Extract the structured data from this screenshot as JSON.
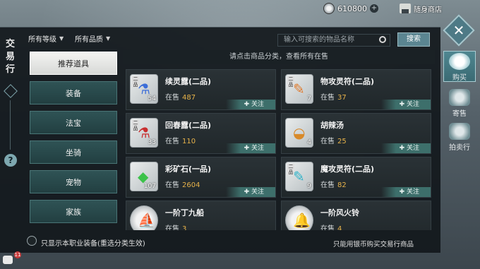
{
  "topbar": {
    "currency_value": "610800",
    "shop_label": "随身商店"
  },
  "sidebar": {
    "title": "交易行"
  },
  "filters": {
    "level": "所有等级",
    "quality": "所有品质"
  },
  "search": {
    "placeholder": "输入可搜索的物品名称",
    "button_label": "搜索"
  },
  "categories": [
    {
      "label": "推荐道具",
      "active": true
    },
    {
      "label": "装备"
    },
    {
      "label": "法宝"
    },
    {
      "label": "坐骑"
    },
    {
      "label": "宠物"
    },
    {
      "label": "家族"
    }
  ],
  "hint": "请点击商品分类，查看所有在售",
  "sale_label": "在售",
  "follow_label": "关注",
  "items": [
    {
      "name": "续灵露(二品)",
      "count_on_sale": "487",
      "stack": "54",
      "grade": "二品",
      "icon": "blue-potion-icon",
      "glyph": "⚗",
      "glyph_color": "#3c6ed8"
    },
    {
      "name": "物攻灵符(二品)",
      "count_on_sale": "37",
      "stack": "7",
      "grade": "二品",
      "icon": "orange-talisman-icon",
      "glyph": "✎",
      "glyph_color": "#e07a2c"
    },
    {
      "name": "回春露(二品)",
      "count_on_sale": "110",
      "stack": "33",
      "grade": "二品",
      "icon": "red-potion-icon",
      "glyph": "⚗",
      "glyph_color": "#c83030"
    },
    {
      "name": "胡辣汤",
      "count_on_sale": "25",
      "stack": "4",
      "grade": "",
      "icon": "soup-bowl-icon",
      "glyph": "◒",
      "glyph_color": "#d88a2a"
    },
    {
      "name": "彩矿石(一品)",
      "count_on_sale": "2604",
      "stack": "107",
      "grade": "",
      "icon": "green-ore-icon",
      "glyph": "◆",
      "glyph_color": "#3cc24a"
    },
    {
      "name": "魔攻灵符(二品)",
      "count_on_sale": "82",
      "stack": "9",
      "grade": "二品",
      "icon": "cyan-talisman-icon",
      "glyph": "✎",
      "glyph_color": "#2fb3c8"
    },
    {
      "name": "一阶丁九船",
      "count_on_sale": "3",
      "stack": "",
      "grade": "",
      "icon": "boat-icon",
      "glyph": "⛵",
      "glyph_color": "#4a66b8"
    },
    {
      "name": "一阶风火铃",
      "count_on_sale": "4",
      "stack": "",
      "grade": "",
      "icon": "fire-bell-icon",
      "glyph": "🔔",
      "glyph_color": "#d06b25"
    }
  ],
  "footer": {
    "left_text": "只显示本职业装备(重选分类生效)",
    "right_text": "只能用银币购买交易行商品"
  },
  "right_tabs": [
    {
      "label": "购买",
      "active": true,
      "icon": "buy-icon"
    },
    {
      "label": "寄售",
      "active": false,
      "icon": "consign-icon"
    },
    {
      "label": "拍卖行",
      "active": false,
      "icon": "auction-scale-icon"
    }
  ],
  "chat": {
    "badge": "11"
  }
}
